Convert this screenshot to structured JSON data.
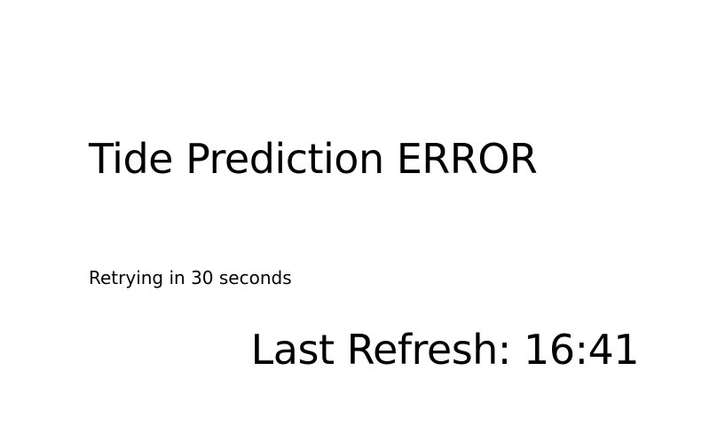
{
  "error": {
    "title": "Tide Prediction ERROR",
    "retry_message": "Retrying in 30 seconds"
  },
  "status": {
    "last_refresh": "Last Refresh: 16:41"
  },
  "colors": {
    "background": "#ffffff",
    "text": "#000000"
  }
}
